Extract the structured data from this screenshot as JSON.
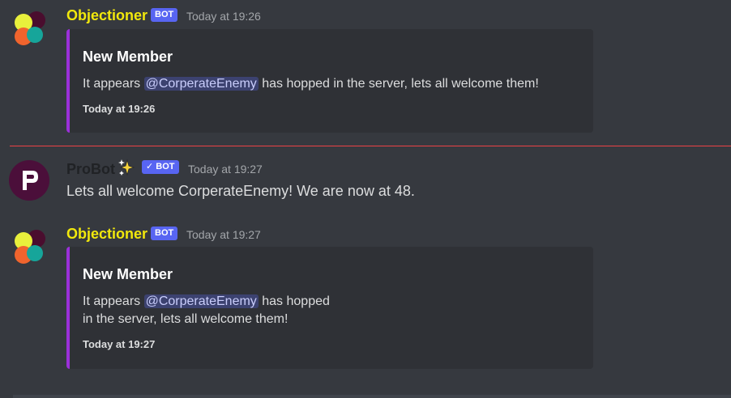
{
  "colors": {
    "background": "#36393f",
    "embed_background": "#2f3136",
    "embed_accent": "#9b30d9",
    "objectioner_name": "#f1e80c",
    "probot_name": "#202225",
    "bot_tag": "#5865f2",
    "new_message_divider": "#ed4245"
  },
  "messages": [
    {
      "author": "Objectioner",
      "bot_tag": "BOT",
      "timestamp": "Today at 19:26",
      "embed": {
        "title": "New Member",
        "description_prefix": "It appears",
        "mention": "@CorperateEnemy",
        "description_suffix": "has hopped in the server, lets all welcome them!",
        "footer": "Today at 19:26"
      }
    },
    {
      "author": "ProBot",
      "author_badge_icon": "sparkles-icon",
      "bot_tag": "✓ BOT",
      "timestamp": "Today at 19:27",
      "content": "Lets all welcome CorperateEnemy! We are now at 48."
    },
    {
      "author": "Objectioner",
      "bot_tag": "BOT",
      "timestamp": "Today at 19:27",
      "embed": {
        "title": "New Member",
        "description_prefix": "It appears",
        "mention": "@CorperateEnemy",
        "description_suffix": "has hopped",
        "description_line2": "in the server, lets all welcome them!",
        "footer": "Today at 19:27"
      }
    }
  ]
}
